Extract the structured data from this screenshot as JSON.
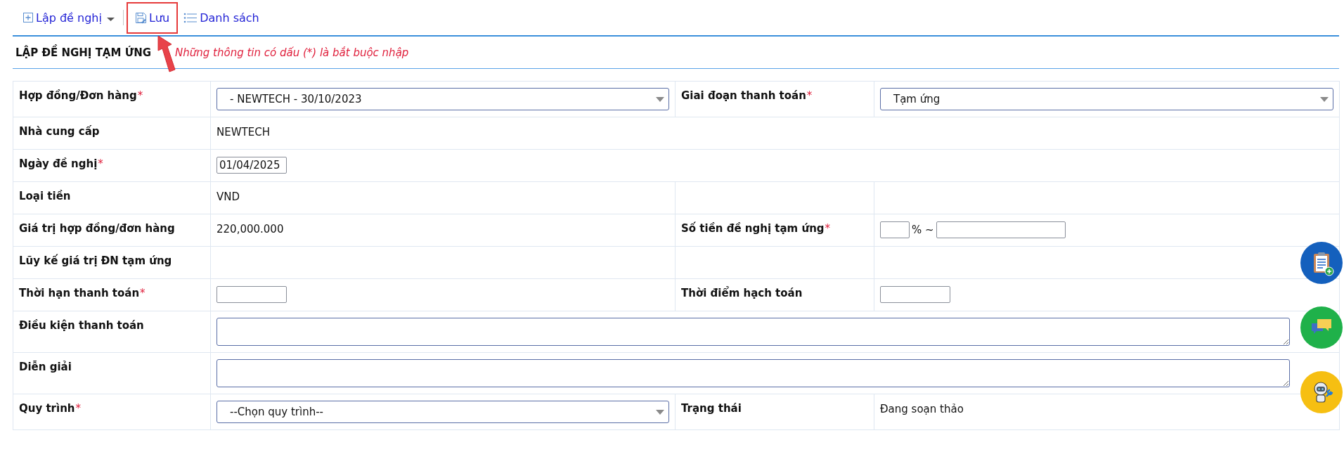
{
  "toolbar": [
    {
      "kind": "create",
      "label": "Lập đề nghị",
      "dropdown": true,
      "highlighted": false
    },
    {
      "kind": "save",
      "label": "Lưu",
      "dropdown": false,
      "highlighted": true
    },
    {
      "kind": "list",
      "label": "Danh sách",
      "dropdown": false,
      "highlighted": false
    }
  ],
  "section": {
    "title": "LẬP ĐỀ NGHỊ TẠM ỨNG",
    "note": "Những thông tin có dấu (*) là bắt buộc nhập"
  },
  "form": {
    "rows": [
      {
        "kind": "pair",
        "fields": [
          {
            "label": "Hợp đồng/Đơn hàng",
            "required_mark": "*",
            "kind": "select",
            "value": "- NEWTECH - 30/10/2023"
          },
          {
            "label": "Giai đoạn thanh toán",
            "required_mark": "*",
            "kind": "select",
            "value": "Tạm ứng"
          }
        ]
      },
      {
        "kind": "wide",
        "fields": [
          {
            "label": "Nhà cung cấp",
            "kind": "text",
            "value": "NEWTECH"
          }
        ]
      },
      {
        "kind": "wide",
        "fields": [
          {
            "label": "Ngày đề nghị",
            "required_mark": "*",
            "kind": "input",
            "value": "01/04/2025"
          }
        ]
      },
      {
        "kind": "pair",
        "fields": [
          {
            "label": "Loại tiền",
            "kind": "text",
            "value": "VND"
          }
        ]
      },
      {
        "kind": "pair",
        "fields": [
          {
            "label": "Giá trị hợp đồng/đơn hàng",
            "kind": "text",
            "value": "220,000.000"
          },
          {
            "label": "Số tiền đề nghị tạm ứng",
            "required_mark": "*",
            "kind": "percent",
            "separator": "% ~"
          }
        ]
      },
      {
        "kind": "pair",
        "fields": [
          {
            "label": "Lũy kế giá trị ĐN tạm ứng",
            "kind": "text"
          }
        ]
      },
      {
        "kind": "pair",
        "fields": [
          {
            "label": "Thời hạn thanh toán",
            "required_mark": "*",
            "kind": "input"
          },
          {
            "label": "Thời điểm hạch toán",
            "kind": "input"
          }
        ]
      },
      {
        "kind": "wide",
        "fields": [
          {
            "label": "Điều kiện thanh toán",
            "kind": "textarea"
          }
        ]
      },
      {
        "kind": "wide",
        "fields": [
          {
            "label": "Diễn giải",
            "kind": "textarea"
          }
        ]
      },
      {
        "kind": "pair",
        "fields": [
          {
            "label": "Quy trình",
            "required_mark": "*",
            "kind": "select",
            "value": "--Chọn quy trình--"
          },
          {
            "label": "Trạng thái",
            "kind": "text",
            "value": "Đang soạn thảo"
          }
        ]
      }
    ]
  },
  "floating_buttons": [
    {
      "kind": "request"
    },
    {
      "kind": "chat"
    },
    {
      "kind": "support"
    }
  ]
}
